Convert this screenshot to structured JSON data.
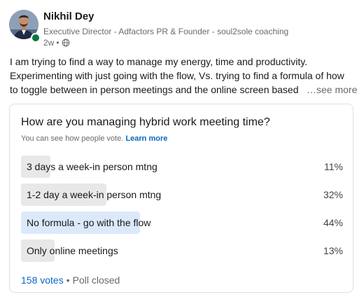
{
  "author": {
    "name": "Nikhil Dey",
    "headline": "Executive Director - Adfactors PR & Founder - soul2sole coaching",
    "time": "2w",
    "visibility_icon": "globe-icon"
  },
  "post": {
    "lines": [
      "I am trying to find a way to manage my energy, time and productivity.",
      "Experimenting with just going with the flow, Vs. trying to find a formula of how",
      "to toggle between in person meetings and the online screen based"
    ],
    "see_more": "…see more"
  },
  "poll": {
    "question": "How are you managing hybrid work meeting time?",
    "subtitle": "You can see how people vote.",
    "learn_more": "Learn more",
    "options": [
      {
        "label": "3 days a week-in person mtng",
        "percent": "11%",
        "share": 0.11
      },
      {
        "label": "1-2 day a week-in person mtng",
        "percent": "32%",
        "share": 0.32
      },
      {
        "label": "No formula - go with the flow",
        "percent": "44%",
        "share": 0.44,
        "selected": true
      },
      {
        "label": "Only online meetings",
        "percent": "13%",
        "share": 0.13
      }
    ],
    "votes": "158 votes",
    "status": "Poll closed"
  },
  "colors": {
    "accent": "#0a66c2",
    "online": "#057642",
    "bar": "#e8e8e8",
    "bar_selected": "#dce9fb"
  }
}
